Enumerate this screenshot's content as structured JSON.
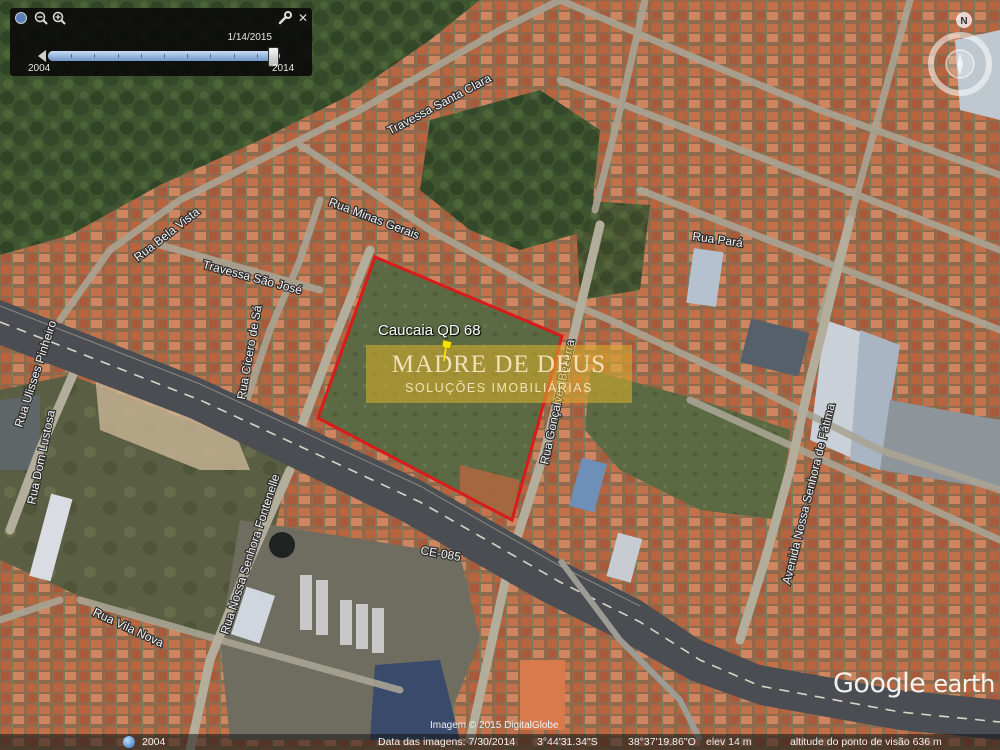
{
  "time_slider": {
    "date": "1/14/2015",
    "start_year": "2004",
    "end_year": "2014",
    "position": 0.97,
    "icons": [
      "sun-icon",
      "zoom-out-icon",
      "zoom-in-icon",
      "wrench-icon",
      "close-icon"
    ]
  },
  "parcel": {
    "label": "Caucaia QD 68",
    "outline_color": "#d81b1b",
    "pin_color": "#f5e10a"
  },
  "watermark": {
    "title": "MADRE DE DEUS",
    "subtitle": "SOLUÇÕES IMOBILIÁRIAS"
  },
  "road_labels": [
    "Travessa Santa Clara",
    "Rua Minas Gerais",
    "Rua Bela Vista",
    "Travessa São José",
    "Rua Pará",
    "Rua Cícero de Sá",
    "Rua Gonçalves Bezerra",
    "Rua Dom Lustosa",
    "Avenida Nossa Senhora de Fátima",
    "Rua Ulisses Pinheiro",
    "Rua Nossa Senhora Fontenelle",
    "Rua Vila Nova",
    "CE-085"
  ],
  "compass": {
    "north_label": "N"
  },
  "logo": {
    "brand": "Google",
    "product": "earth"
  },
  "status_bar": {
    "year": "2004",
    "imagery_date": "Data das imagens: 7/30/2014",
    "latitude": "3°44'31.34\"S",
    "longitude": "38°37'19.86\"O",
    "elevation": "elev    14 m",
    "eye_altitude": "altitude do ponto de visão  636 m",
    "copyright": "Imagem © 2015 DigitalGlobe"
  }
}
